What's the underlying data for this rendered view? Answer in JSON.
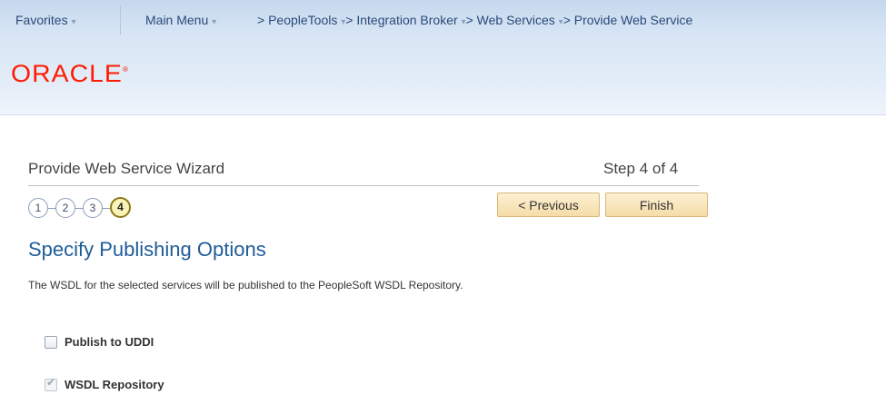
{
  "menu": {
    "favorites": "Favorites",
    "main_menu": "Main Menu",
    "crumbs": [
      "PeopleTools",
      "Integration Broker",
      "Web Services",
      "Provide Web Service"
    ]
  },
  "brand": {
    "logo_text": "ORACLE"
  },
  "wizard": {
    "title": "Provide Web Service Wizard",
    "step_label": "Step 4 of 4",
    "steps": [
      "1",
      "2",
      "3",
      "4"
    ],
    "active_step": 4,
    "previous_label": "< Previous",
    "finish_label": "Finish"
  },
  "content": {
    "heading": "Specify Publishing Options",
    "description": "The WSDL for the selected services will be published to the PeopleSoft WSDL Repository.",
    "options": [
      {
        "label": "Publish to UDDI",
        "checked": false,
        "disabled": false
      },
      {
        "label": "WSDL Repository",
        "checked": true,
        "disabled": true
      }
    ]
  },
  "colors": {
    "logo": "#ff1a00",
    "heading": "#1f5c99",
    "button_bg": "#f5dca8",
    "active_step_bg": "#f9f3b6"
  }
}
